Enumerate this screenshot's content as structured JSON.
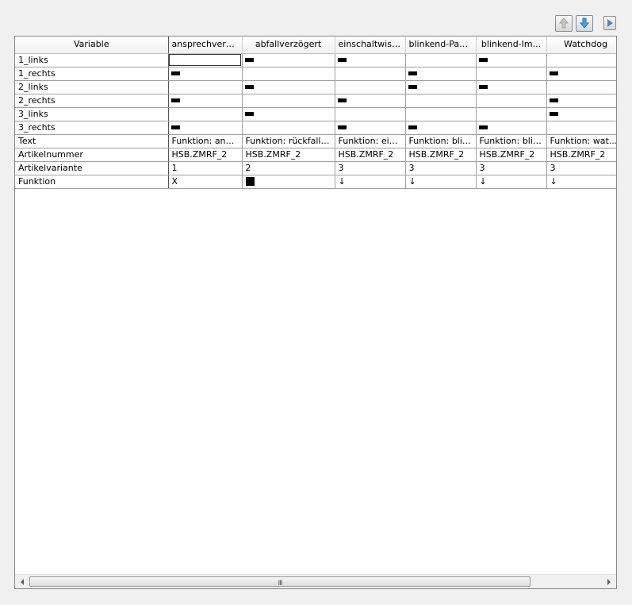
{
  "toolbar": {
    "up_icon": "arrow-up-icon",
    "down_icon": "arrow-down-icon",
    "next_icon": "play-right-icon"
  },
  "table": {
    "header": {
      "variable": "Variable",
      "columns": [
        "ansprechverz...",
        "abfallverzögert",
        "einschaltwisc...",
        "blinkend-Pau...",
        "blinkend-Im...",
        "Watchdog"
      ]
    },
    "mark_rows": [
      {
        "label": "1_links",
        "marks": [
          false,
          true,
          true,
          false,
          true,
          false
        ]
      },
      {
        "label": "1_rechts",
        "marks": [
          true,
          false,
          false,
          true,
          false,
          true
        ]
      },
      {
        "label": "2_links",
        "marks": [
          false,
          true,
          false,
          true,
          true,
          false
        ]
      },
      {
        "label": "2_rechts",
        "marks": [
          true,
          false,
          true,
          false,
          false,
          true
        ]
      },
      {
        "label": "3_links",
        "marks": [
          false,
          true,
          false,
          false,
          false,
          true
        ]
      },
      {
        "label": "3_rechts",
        "marks": [
          true,
          false,
          true,
          true,
          true,
          false
        ]
      }
    ],
    "text_rows": [
      {
        "label": "Text",
        "cells": [
          "Funktion: ans...",
          "Funktion: rückfallv...",
          "Funktion: ein...",
          "Funktion: blin...",
          "Funktion: blin...",
          "Funktion: wat..."
        ]
      },
      {
        "label": "Artikelnummer",
        "cells": [
          "HSB.ZMRF_2",
          "HSB.ZMRF_2",
          "HSB.ZMRF_2",
          "HSB.ZMRF_2",
          "HSB.ZMRF_2",
          "HSB.ZMRF_2"
        ]
      },
      {
        "label": "Artikelvariante",
        "cells": [
          "1",
          "2",
          "3",
          "3",
          "3",
          "3"
        ]
      },
      {
        "label": "Funktion",
        "cells": [
          "X",
          "",
          "↓",
          "↓",
          "↓",
          "↓"
        ],
        "square_column": 1
      }
    ],
    "selected_cell": {
      "row": 0,
      "col": 0
    }
  },
  "scrollbar": {
    "grip": "III",
    "left_icon": "scroll-left-icon",
    "right_icon": "scroll-right-icon",
    "position_fraction": 0.0
  }
}
